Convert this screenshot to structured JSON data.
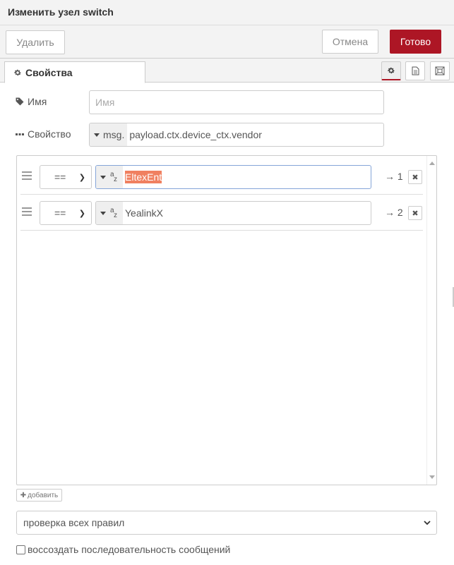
{
  "header": {
    "title": "Изменить узел switch"
  },
  "toolbar": {
    "delete_label": "Удалить",
    "cancel_label": "Отмена",
    "done_label": "Готово"
  },
  "tabs": {
    "properties_label": "Свойства"
  },
  "form": {
    "name_label": "Имя",
    "name_placeholder": "Имя",
    "name_value": "",
    "property_label": "Свойство",
    "property_type": "msg.",
    "property_value": "payload.ctx.device_ctx.vendor"
  },
  "rules": [
    {
      "operator": "==",
      "value_type": "str",
      "value": "EltexEnt",
      "output": "→ 1"
    },
    {
      "operator": "==",
      "value_type": "str",
      "value": "YealinkX",
      "output": "→ 2"
    }
  ],
  "add_button_label": "добавить",
  "check_mode": "проверка всех правил",
  "recreate_label": "воссоздать последовательность сообщений",
  "colors": {
    "accent": "#ad1625",
    "highlight": "#f08060",
    "focus_border": "#85a5d8"
  },
  "icons": [
    "gear-icon",
    "document-icon",
    "frame-icon",
    "tag-icon",
    "ellipsis-icon",
    "drag-handle-icon",
    "caret-down-icon",
    "string-type-icon",
    "close-icon",
    "plus-icon"
  ]
}
